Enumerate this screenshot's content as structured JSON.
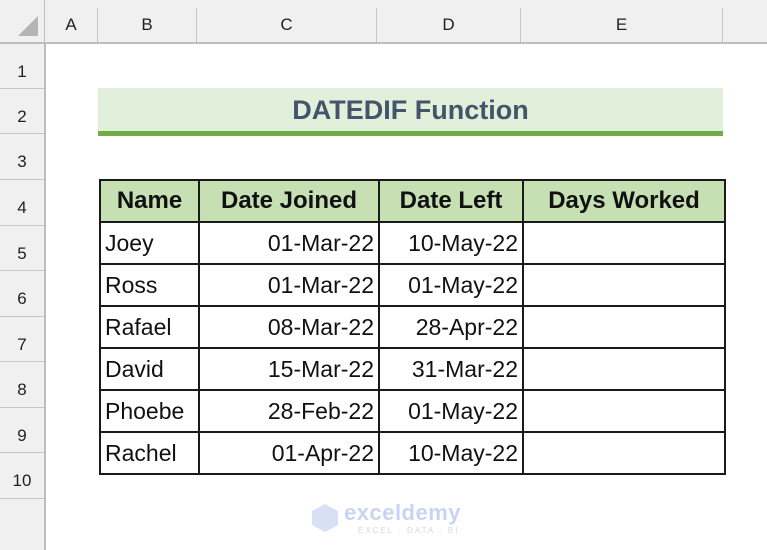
{
  "sheet": {
    "columns": [
      "A",
      "B",
      "C",
      "D",
      "E"
    ],
    "rows": [
      "1",
      "2",
      "3",
      "4",
      "5",
      "6",
      "7",
      "8",
      "9",
      "10"
    ]
  },
  "title": "DATEDIF Function",
  "table": {
    "headers": [
      "Name",
      "Date Joined",
      "Date Left",
      "Days Worked"
    ],
    "rows": [
      {
        "name": "Joey",
        "joined": "01-Mar-22",
        "left": "10-May-22",
        "days": ""
      },
      {
        "name": "Ross",
        "joined": "01-Mar-22",
        "left": "01-May-22",
        "days": ""
      },
      {
        "name": "Rafael",
        "joined": "08-Mar-22",
        "left": "28-Apr-22",
        "days": ""
      },
      {
        "name": "David",
        "joined": "15-Mar-22",
        "left": "31-Mar-22",
        "days": ""
      },
      {
        "name": "Phoebe",
        "joined": "28-Feb-22",
        "left": "01-May-22",
        "days": ""
      },
      {
        "name": "Rachel",
        "joined": "01-Apr-22",
        "left": "10-May-22",
        "days": ""
      }
    ]
  },
  "watermark": {
    "brand": "exceldemy",
    "tagline": "EXCEL · DATA · BI"
  },
  "colors": {
    "title_bg": "#e2efda",
    "title_border": "#70ad47",
    "title_text": "#44546a",
    "header_bg": "#c6e0b4"
  }
}
